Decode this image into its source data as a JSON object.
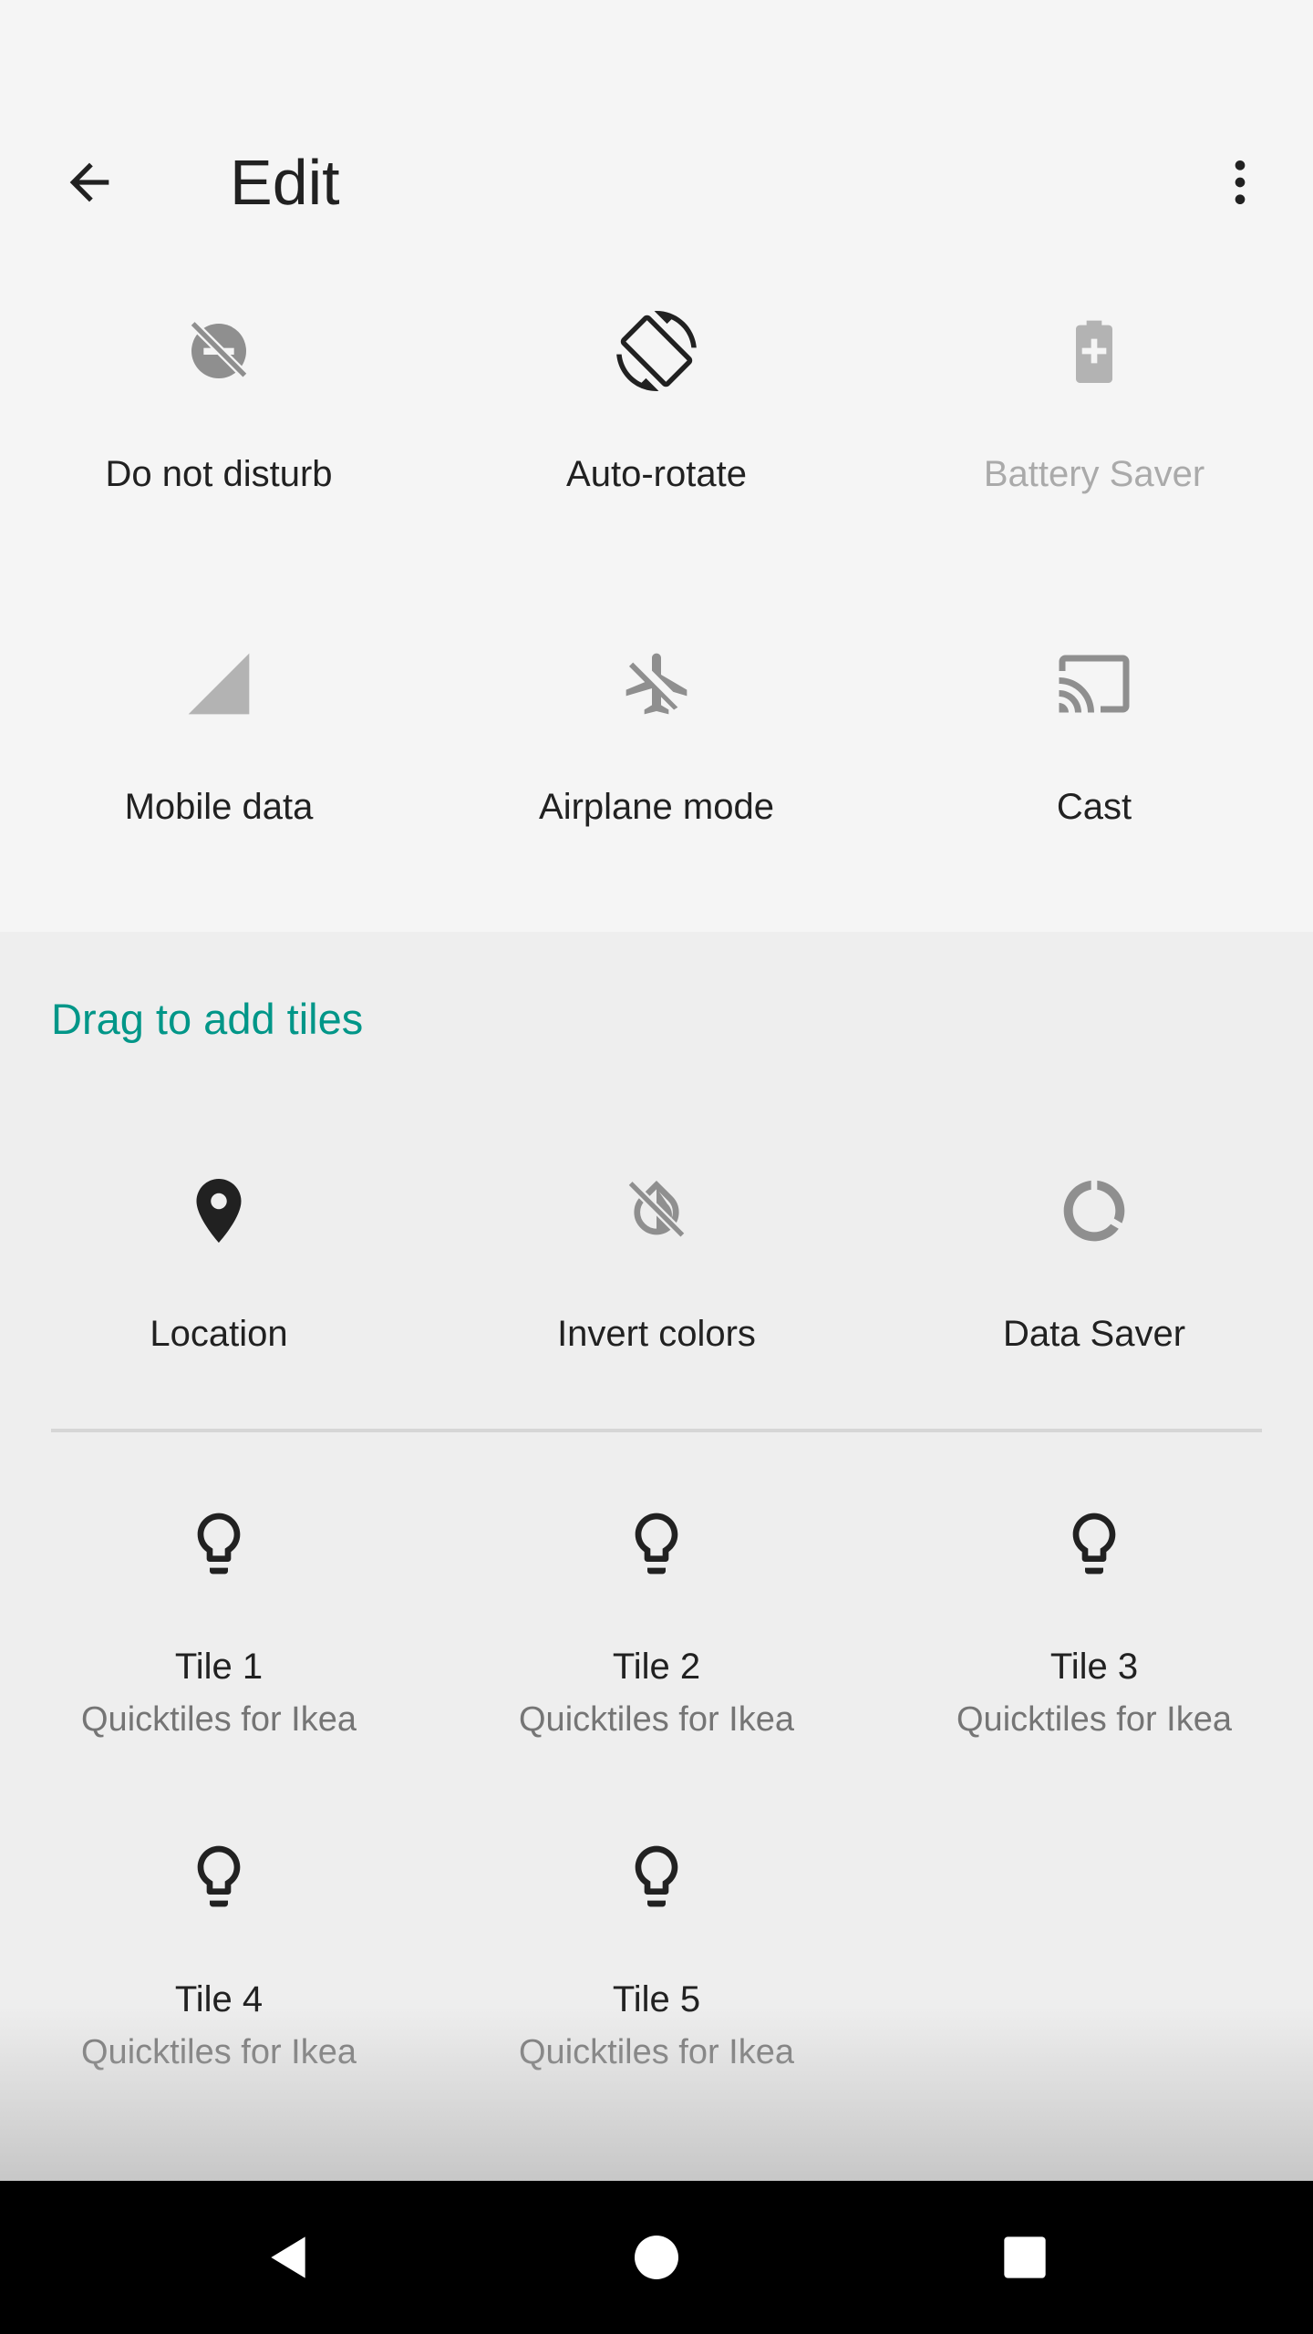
{
  "appbar": {
    "title": "Edit",
    "back_icon": "arrow-back-icon",
    "more_icon": "more-vert-icon"
  },
  "current_tiles": [
    {
      "label": "Do not disturb",
      "icon": "do-not-disturb-icon",
      "enabled": true
    },
    {
      "label": "Auto-rotate",
      "icon": "auto-rotate-icon",
      "enabled": true
    },
    {
      "label": "Battery Saver",
      "icon": "battery-saver-icon",
      "enabled": false
    },
    {
      "label": "Mobile data",
      "icon": "signal-icon",
      "enabled": true
    },
    {
      "label": "Airplane mode",
      "icon": "airplane-icon",
      "enabled": true
    },
    {
      "label": "Cast",
      "icon": "cast-icon",
      "enabled": true
    }
  ],
  "add_section": {
    "heading": "Drag to add tiles",
    "accent_color": "#009688",
    "system_tiles": [
      {
        "label": "Location",
        "icon": "location-pin-icon"
      },
      {
        "label": "Invert colors",
        "icon": "invert-colors-icon"
      },
      {
        "label": "Data Saver",
        "icon": "data-saver-icon"
      }
    ],
    "app_tiles": [
      {
        "label": "Tile 1",
        "sub": "Quicktiles for Ikea",
        "icon": "lightbulb-icon"
      },
      {
        "label": "Tile 2",
        "sub": "Quicktiles for Ikea",
        "icon": "lightbulb-icon"
      },
      {
        "label": "Tile 3",
        "sub": "Quicktiles for Ikea",
        "icon": "lightbulb-icon"
      },
      {
        "label": "Tile 4",
        "sub": "Quicktiles for Ikea",
        "icon": "lightbulb-icon"
      },
      {
        "label": "Tile 5",
        "sub": "Quicktiles for Ikea",
        "icon": "lightbulb-icon"
      }
    ]
  },
  "navbar": {
    "back_icon": "nav-back-icon",
    "home_icon": "nav-home-icon",
    "recents_icon": "nav-recents-icon"
  }
}
